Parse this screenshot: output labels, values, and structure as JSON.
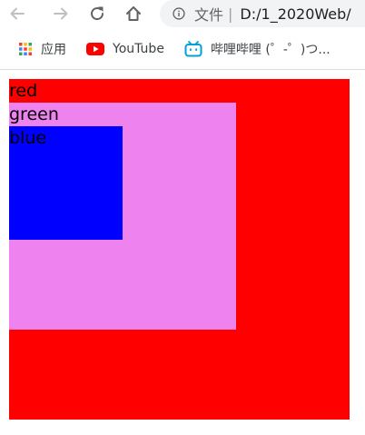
{
  "browser": {
    "address_prefix": "文件",
    "address_separator": "|",
    "url": "D:/1_2020Web/",
    "nav_icons": [
      "back-arrow-icon",
      "forward-arrow-icon",
      "reload-icon",
      "home-icon",
      "info-icon"
    ]
  },
  "bookmarks": {
    "items": [
      {
        "label": "应用",
        "icon": "apps-grid-icon"
      },
      {
        "label": "YouTube",
        "icon": "youtube-icon"
      },
      {
        "label": "哔哩哔哩 (゜-゜)つ...",
        "icon": "bilibili-icon"
      }
    ]
  },
  "page": {
    "boxes": [
      {
        "label": "red",
        "color": "#ff0000"
      },
      {
        "label": "green",
        "color": "#ee82ee"
      },
      {
        "label": "blue",
        "color": "#0000ff"
      }
    ]
  },
  "colors": {
    "toolbar_bg": "#ffffff",
    "address_bg": "#f1f3f4",
    "icon_gray": "#5f6368",
    "disabled_gray": "#bdc1c6",
    "youtube_red": "#ff0000",
    "bilibili_blue": "#00a1d6"
  }
}
